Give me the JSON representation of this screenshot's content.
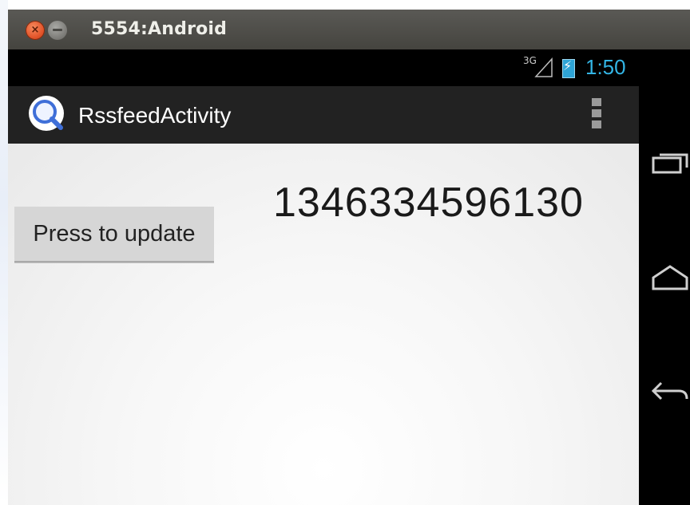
{
  "window": {
    "title": "5554:Android",
    "close_glyph": "×"
  },
  "status_bar": {
    "network": "3G",
    "time": "1:50",
    "battery_icon": "battery-charging-icon",
    "signal_icon": "signal-icon"
  },
  "action_bar": {
    "title": "RssfeedActivity",
    "app_icon": "search-icon",
    "overflow_icon": "overflow-menu-icon"
  },
  "main": {
    "counter_value": "1346334596130",
    "update_button_label": "Press to update"
  },
  "nav_bar": {
    "recent_icon": "recent-apps-icon",
    "home_icon": "home-icon",
    "back_icon": "back-icon"
  },
  "colors": {
    "accent": "#33b5e5",
    "action_bar": "#222222",
    "button": "#d6d6d6"
  }
}
